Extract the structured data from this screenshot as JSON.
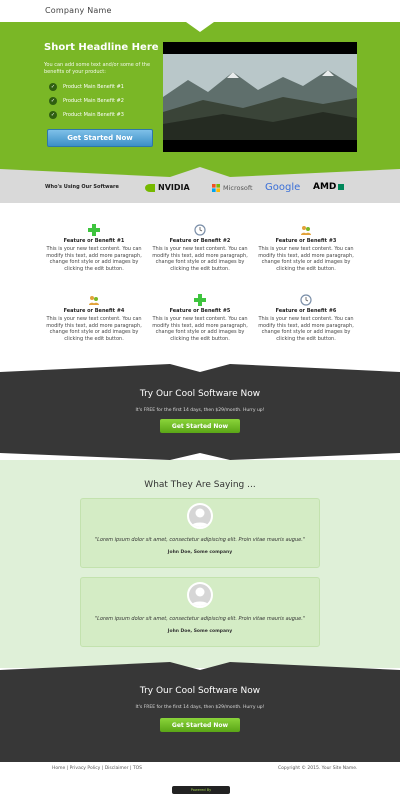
{
  "header": {
    "company": "Company Name"
  },
  "hero": {
    "headline": "Short Headline Here",
    "subtext": "You can add some text and/or some of the benefits of your product:",
    "benefits": [
      "Product Main Benefit #1",
      "Product Main Benefit #2",
      "Product Main Benefit #3"
    ],
    "cta": "Get Started Now"
  },
  "logos": {
    "title": "Who's Using Our Software",
    "items": [
      "NVIDIA",
      "Microsoft",
      "Google",
      "AMD"
    ]
  },
  "features": [
    {
      "title": "Feature or Benefit #1",
      "text": "This is your new text content. You can modify this text, add more paragraph, change font style or add images by clicking the edit button.",
      "icon": "plus-icon"
    },
    {
      "title": "Feature or Benefit #2",
      "text": "This is your new text content. You can modify this text, add more paragraph, change font style or add images by clicking the edit button.",
      "icon": "clock-icon"
    },
    {
      "title": "Feature or Benefit #3",
      "text": "This is your new text content. You can modify this text, add more paragraph, change font style or add images by clicking the edit button.",
      "icon": "people-icon"
    },
    {
      "title": "Feature or Benefit #4",
      "text": "This is your new text content. You can modify this text, add more paragraph, change font style or add images by clicking the edit button.",
      "icon": "people-icon"
    },
    {
      "title": "Feature or Benefit #5",
      "text": "This is your new text content. You can modify this text, add more paragraph, change font style or add images by clicking the edit button.",
      "icon": "plus-icon"
    },
    {
      "title": "Feature or Benefit #6",
      "text": "This is your new text content. You can modify this text, add more paragraph, change font style or add images by clicking the edit button.",
      "icon": "clock-icon"
    }
  ],
  "cta1": {
    "title": "Try Our Cool Software Now",
    "sub": "It's FREE for the first 14 days, then $29/month. Hurry up!",
    "button": "Get Started Now"
  },
  "testimonials": {
    "title": "What They Are Saying ...",
    "items": [
      {
        "quote": "\"Lorem ipsum dolor sit amet, consectetur adipiscing elit. Proin vitae mauris augue.\"",
        "author": "John Doe, Some company"
      },
      {
        "quote": "\"Lorem ipsum dolor sit amet, consectetur adipiscing elit. Proin vitae mauris augue.\"",
        "author": "John Doe, Some company"
      }
    ]
  },
  "cta2": {
    "title": "Try Our Cool Software Now",
    "sub": "It's FREE for the first 14 days, then $29/month. Hurry up!",
    "button": "Get Started Now"
  },
  "footer": {
    "links": "Home | Privacy Policy | Disclaimer | TOS",
    "copyright": "Copyright © 2015. Your Site Name.",
    "powered": "Powered By"
  },
  "colors": {
    "hero": "#7ab726",
    "dark": "#373737",
    "light": "#dff0d8",
    "button_blue": "#3b8fc7",
    "button_green": "#5aa516"
  }
}
